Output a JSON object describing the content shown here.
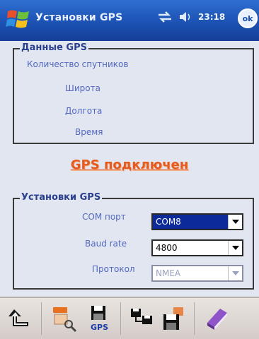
{
  "window": {
    "title": "Установки GPS",
    "clock": "23:18",
    "ok_label": "ok"
  },
  "icons": {
    "start": "windows-logo-icon",
    "connectivity": "connectivity-icon",
    "volume": "speaker-icon"
  },
  "data_group": {
    "title": "Данные GPS",
    "satellites_label": "Количество спутников",
    "latitude_label": "Широта",
    "longitude_label": "Долгота",
    "time_label": "Время"
  },
  "status_text": "GPS подключен",
  "settings_group": {
    "title": "Установки GPS",
    "com_port": {
      "label": "COM порт",
      "value": "COM8"
    },
    "baud_rate": {
      "label": "Baud rate",
      "value": "4800"
    },
    "protocol": {
      "label": "Протокол",
      "value": "NMEA"
    }
  },
  "toolbar": {
    "back": "back-arrow-icon",
    "search": "search-device-icon",
    "save_gps": "gps-save-icon",
    "network": "network-icon",
    "save": "save-icon",
    "book": "book-icon",
    "gps_text": "GPS"
  },
  "colors": {
    "title_bar": "#1a4fb0",
    "label_text": "#5468c0",
    "status_text": "#e35b20",
    "selected_value": "#0d2a9a"
  }
}
